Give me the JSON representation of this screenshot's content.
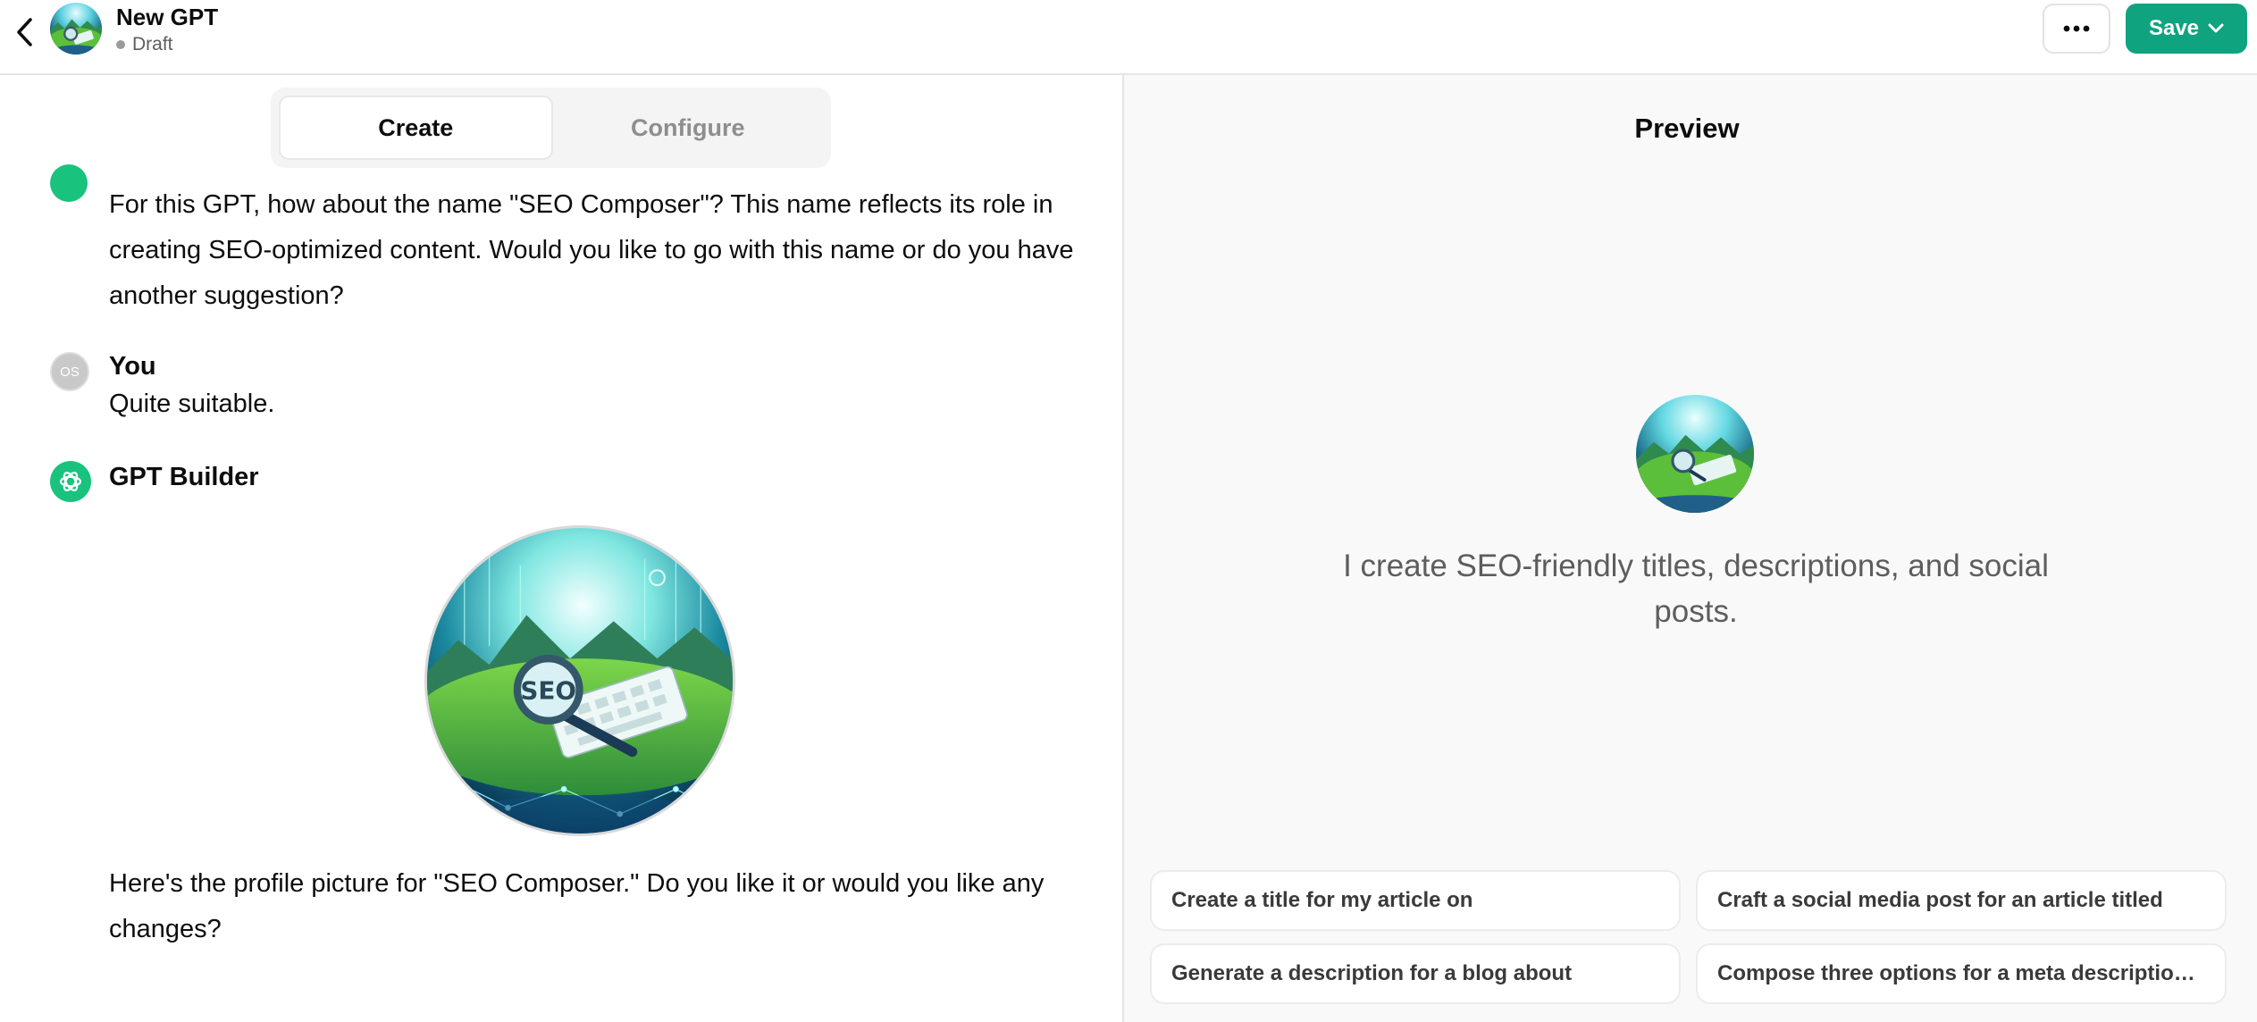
{
  "header": {
    "gpt_name": "New GPT",
    "status": "Draft",
    "save_label": "Save",
    "icons": {
      "back": "chevron-left-icon",
      "more": "ellipsis-icon",
      "save_dropdown": "chevron-down-icon"
    }
  },
  "tabs": [
    {
      "label": "Create",
      "active": true
    },
    {
      "label": "Configure",
      "active": false
    }
  ],
  "conversation": {
    "builder_message_1": "For this GPT, how about the name \"SEO Composer\"? This name reflects its role in creating SEO-optimized content. Would you like to go with this name or do you have another suggestion?",
    "user": {
      "initials": "OS",
      "name": "You",
      "message": "Quite suitable."
    },
    "builder": {
      "name": "GPT Builder"
    },
    "builder_message_2": "Here's the profile picture for \"SEO Composer.\" Do you like it or would you like any changes?"
  },
  "preview": {
    "title": "Preview",
    "description": "I create SEO-friendly titles, descriptions, and social posts.",
    "conversation_starters": [
      "Create a title for my article on",
      "Craft a social media post for an article titled",
      "Generate a description for a blog about",
      "Compose three options for a meta description ..."
    ]
  },
  "colors": {
    "accent": "#10a37f",
    "builder_icon": "#19c37d",
    "preview_bg": "#f9f9f9"
  }
}
